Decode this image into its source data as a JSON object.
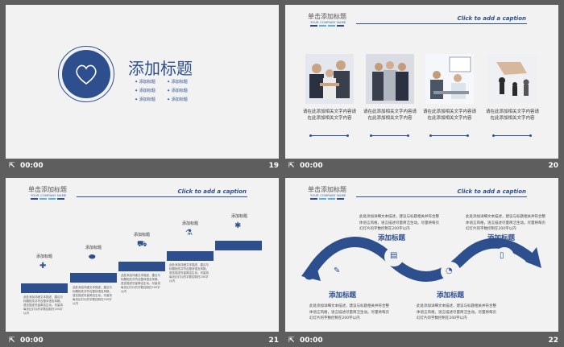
{
  "slides": [
    {
      "number": "19",
      "time": "00:00",
      "title": "添加标题",
      "bullets": [
        "添加标题",
        "添加标题",
        "添加标题",
        "添加标题",
        "添加标题",
        "添加标题"
      ]
    },
    {
      "number": "20",
      "time": "00:00",
      "header": "单击添加标题",
      "header_sub": "YOUR COMPANY NAME",
      "caption": "Click to add a caption",
      "items": [
        "请在此添加相关文字内容请在此添加相关文字内容",
        "请在此添加相关文字内容请在此添加相关文字内容",
        "请在此添加相关文字内容请在此添加相关文字内容",
        "请在此添加相关文字内容请在此添加相关文字内容"
      ]
    },
    {
      "number": "21",
      "time": "00:00",
      "header": "单击添加标题",
      "header_sub": "YOUR COMPANY NAME",
      "caption": "Click to add a caption",
      "steps": [
        {
          "label": "添加标题",
          "text": "此处添加详细文本描述，建议与标题相关并符合整体语言风格，语言描述尽量简洁生动。尽量将每页幻灯片的字数控制在200字以内"
        },
        {
          "label": "添加标题",
          "text": "此处添加详细文本描述，建议与标题相关并符合整体语言风格，语言描述尽量简洁生动。尽量将每页幻灯片的字数控制在200字以内"
        },
        {
          "label": "添加标题",
          "text": "此处添加详细文本描述，建议与标题相关并符合整体语言风格，语言描述尽量简洁生动。尽量将每页幻灯片的字数控制在200字以内"
        },
        {
          "label": "添加标题",
          "text": "此处添加详细文本描述，建议与标题相关并符合整体语言风格，语言描述尽量简洁生动。尽量将每页幻灯片的字数控制在200字以内"
        },
        {
          "label": "添加标题",
          "text": ""
        }
      ]
    },
    {
      "number": "22",
      "time": "00:00",
      "header": "单击添加标题",
      "header_sub": "YOUR COMPANY NAME",
      "caption": "Click to add a caption",
      "blocks": [
        {
          "title": "添加标题",
          "text": "此处添加详细文本描述，建议与标题相关并符合整体语言风格，语言描述尽量简洁生动。尽量将每页幻灯片的字数控制在200字以内"
        },
        {
          "title": "添加标题",
          "text": "此处添加详细文本描述，建议与标题相关并符合整体语言风格，语言描述尽量简洁生动。尽量将每页幻灯片的字数控制在200字以内"
        },
        {
          "title": "添加标题",
          "text": "此处添加详细文本描述，建议与标题相关并符合整体语言风格，语言描述尽量简洁生动。尽量将每页幻灯片的字数控制在200字以内"
        },
        {
          "title": "添加标题",
          "text": "此处添加详细文本描述，建议与标题相关并符合整体语言风格，语言描述尽量简洁生动。尽量将每页幻灯片的字数控制在200字以内"
        }
      ]
    }
  ],
  "colors": {
    "accent": "#2d4f8e",
    "light_accent": "#5ab0d8",
    "slide_bg": "#f2f2f2",
    "page_bg": "#5e5e5e"
  },
  "icons": {
    "play": "play-icon",
    "heart": "heart-icon"
  }
}
